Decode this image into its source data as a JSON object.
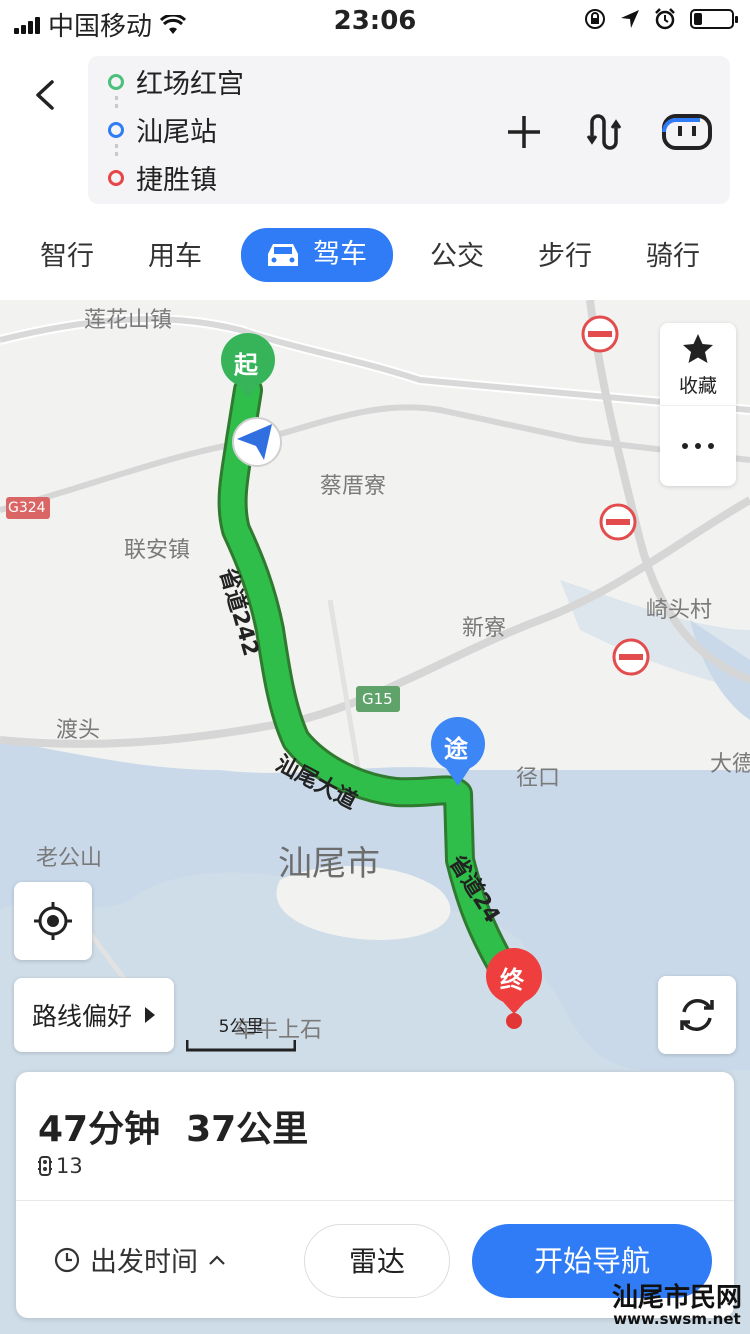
{
  "status": {
    "carrier": "中国移动",
    "time": "23:06"
  },
  "route": {
    "start": "红场红宫",
    "via": "汕尾站",
    "end": "捷胜镇",
    "colors": {
      "start": "#4cc07a",
      "via": "#2f7cf6",
      "end": "#e64646"
    }
  },
  "tabs": [
    {
      "label": "智行"
    },
    {
      "label": "用车"
    },
    {
      "label": "驾车",
      "active": true
    },
    {
      "label": "公交"
    },
    {
      "label": "步行"
    },
    {
      "label": "骑行"
    }
  ],
  "map": {
    "places": [
      "莲花山镇",
      "蔡厝寮",
      "联安镇",
      "新寮",
      "崎头村",
      "渡头",
      "径口",
      "大德",
      "老公山",
      "汕尾市",
      "车牛上石"
    ],
    "roads": [
      "G324",
      "G15",
      "汕尾大道",
      "省道242",
      "省道24"
    ],
    "markers": {
      "start": "起",
      "via": "途",
      "end": "终"
    },
    "side": {
      "favorite": "收藏"
    },
    "route_pref": "路线偏好",
    "scale": "5公里"
  },
  "summary": {
    "duration": "47分钟",
    "distance": "37公里",
    "traffic_lights": "13"
  },
  "actions": {
    "depart_time": "出发时间",
    "radar": "雷达",
    "start_nav": "开始导航"
  },
  "watermark": {
    "title": "汕尾市民网",
    "url": "www.swsm.net"
  }
}
